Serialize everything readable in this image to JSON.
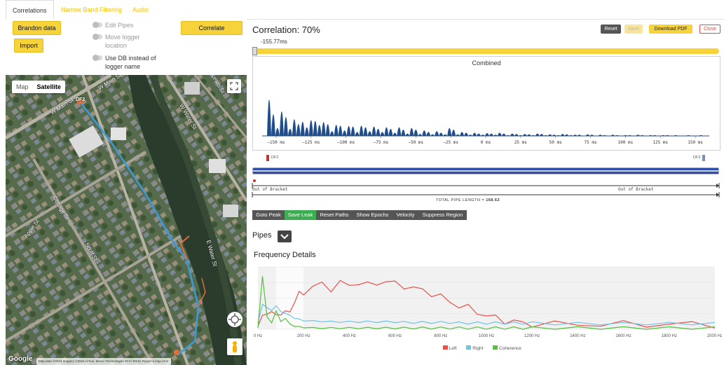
{
  "tabs": [
    {
      "label": "Correlations"
    },
    {
      "label": "Narrow Band Filtering"
    },
    {
      "label": "Audio"
    }
  ],
  "left": {
    "brandon_label": "Brandon data",
    "import_label": "Import",
    "correlate_label": "Correlate",
    "toggles": [
      {
        "label": "Edit Pipes",
        "on": false
      },
      {
        "label": "Move logger location",
        "on": false
      },
      {
        "label": "Use DB instead of logger name",
        "on": false
      }
    ],
    "map": {
      "type_map": "Map",
      "type_satellite": "Satellite",
      "selected_type": "Satellite",
      "street_labels": [
        "W Main St",
        "W Main St",
        "W Water St",
        "Lewis St",
        "Apple St",
        "Cottage St",
        "Scott St",
        "E Water St"
      ],
      "marker_top": "DF2",
      "attribution": "Map data ©2024 Imagery ©2024 Airbus, Maxar Technologies",
      "scale": "20 m",
      "terms": "Terms",
      "report": "Report a map error",
      "logo": "Google"
    }
  },
  "right": {
    "title": "Correlation: 70%",
    "reset_label": "Reset",
    "save_label": "Save",
    "download_label": "Download PDF",
    "close_label": "Close",
    "slider_value": "-155.77ms",
    "slider_position": 0.0,
    "combined_title": "Combined",
    "x_ticks": [
      "−150 ms",
      "−125 ms",
      "−100 ms",
      "−75 ms",
      "−50 ms",
      "−25 ms",
      "0 ms",
      "25 ms",
      "50 ms",
      "75 ms",
      "100 ms",
      "125 ms",
      "150 ms"
    ],
    "left_marker": "DF2",
    "right_marker": "DF3",
    "out_of_bracket_left": "Out of Bracket",
    "out_of_bracket_right": "Out of Bracket",
    "pipe_length_label": "TOTAL PIPE LENGTH = ",
    "pipe_length_value": "168.62",
    "toolbar": [
      {
        "label": "Goto Peak",
        "active": false
      },
      {
        "label": "Save Leak",
        "active": true
      },
      {
        "label": "Reset Paths",
        "active": false
      },
      {
        "label": "Show Epochs",
        "active": false
      },
      {
        "label": "Velocity",
        "active": false
      },
      {
        "label": "Suppress Region",
        "active": false
      }
    ],
    "pipes_label": "Pipes",
    "freq_title": "Frequency Details",
    "freq_ticks": [
      "0 Hz",
      "200 Hz",
      "400 Hz",
      "600 Hz",
      "800 Hz",
      "1000 Hz",
      "1200 Hz",
      "1400 Hz",
      "1600 Hz",
      "1800 Hz",
      "2000 Hz"
    ],
    "legend": [
      {
        "name": "Left",
        "color": "#e8504a"
      },
      {
        "name": "Right",
        "color": "#6fc2ea"
      },
      {
        "name": "Coherence",
        "color": "#52c23a"
      }
    ]
  },
  "colors": {
    "accent_yellow": "#f7d33b",
    "combined_fill": "#1f4e8c",
    "toolbar_bg": "#555555",
    "toolbar_active": "#3cad50"
  },
  "chart_data": [
    {
      "type": "area",
      "title": "Combined",
      "x_unit": "ms",
      "xlim": [
        -160,
        160
      ],
      "x": [
        -155,
        -152,
        -149,
        -146,
        -143,
        -140,
        -137,
        -134,
        -131,
        -128,
        -125,
        -122,
        -119,
        -116,
        -113,
        -110,
        -107,
        -104,
        -101,
        -98,
        -95,
        -92,
        -89,
        -86,
        -83,
        -80,
        -77,
        -74,
        -71,
        -68,
        -65,
        -62,
        -59,
        -56,
        -53,
        -50,
        -47,
        -44,
        -41,
        -38,
        -35,
        -32,
        -29,
        -26,
        -23,
        -20,
        -17,
        -14,
        -11,
        -8,
        -5,
        -2,
        1,
        4,
        7,
        10,
        13,
        16,
        19,
        22,
        25,
        28,
        31,
        34,
        37,
        40,
        43,
        46,
        49,
        52,
        55,
        58,
        61,
        64,
        67,
        70,
        73,
        76,
        79,
        82,
        85,
        88,
        91,
        94,
        97,
        100,
        103,
        106,
        109,
        112,
        115,
        118,
        121,
        124,
        127,
        130,
        133,
        136,
        139,
        142,
        145,
        148,
        151,
        154
      ],
      "y": [
        0.92,
        0.55,
        0.2,
        0.62,
        0.48,
        0.18,
        0.42,
        0.3,
        0.36,
        0.22,
        0.4,
        0.38,
        0.28,
        0.35,
        0.3,
        0.12,
        0.28,
        0.26,
        0.14,
        0.25,
        0.24,
        0.1,
        0.26,
        0.22,
        0.12,
        0.24,
        0.18,
        0.1,
        0.22,
        0.18,
        0.08,
        0.22,
        0.16,
        0.06,
        0.2,
        0.16,
        0.05,
        0.14,
        0.1,
        0.04,
        0.12,
        0.08,
        0.04,
        0.2,
        0.16,
        0.04,
        0.1,
        0.08,
        0.03,
        0.08,
        0.06,
        0.03,
        0.07,
        0.06,
        0.03,
        0.08,
        0.06,
        0.02,
        0.06,
        0.05,
        0.02,
        0.05,
        0.04,
        0.02,
        0.06,
        0.05,
        0.02,
        0.04,
        0.03,
        0.02,
        0.05,
        0.04,
        0.02,
        0.03,
        0.03,
        0.01,
        0.04,
        0.03,
        0.01,
        0.03,
        0.02,
        0.01,
        0.03,
        0.02,
        0.01,
        0.02,
        0.02,
        0.01,
        0.03,
        0.02,
        0.01,
        0.02,
        0.02,
        0.01,
        0.02,
        0.02,
        0.01,
        0.02,
        0.01,
        0.01,
        0.02,
        0.01,
        0.01,
        0.02
      ]
    },
    {
      "type": "line",
      "title": "Frequency Details",
      "x_unit": "Hz",
      "xlim": [
        0,
        2000
      ],
      "x": [
        0,
        20,
        40,
        60,
        80,
        100,
        120,
        140,
        160,
        180,
        200,
        240,
        280,
        320,
        360,
        400,
        440,
        480,
        520,
        560,
        600,
        640,
        680,
        720,
        760,
        800,
        840,
        880,
        920,
        960,
        1000,
        1040,
        1080,
        1120,
        1160,
        1200,
        1300,
        1400,
        1500,
        1600,
        1700,
        1800,
        1900,
        2000
      ],
      "series": [
        {
          "name": "Left",
          "values": [
            0.05,
            0.18,
            0.3,
            0.25,
            0.22,
            0.28,
            0.24,
            0.3,
            0.45,
            0.55,
            0.6,
            0.68,
            0.72,
            0.66,
            0.74,
            0.7,
            0.76,
            0.7,
            0.74,
            0.78,
            0.72,
            0.7,
            0.66,
            0.62,
            0.58,
            0.52,
            0.44,
            0.38,
            0.34,
            0.28,
            0.22,
            0.18,
            0.14,
            0.12,
            0.1,
            0.09,
            0.08,
            0.08,
            0.08,
            0.08,
            0.08,
            0.08,
            0.08,
            0.08
          ]
        },
        {
          "name": "Right",
          "values": [
            0.1,
            0.4,
            0.35,
            0.3,
            0.38,
            0.28,
            0.26,
            0.22,
            0.18,
            0.16,
            0.14,
            0.13,
            0.13,
            0.12,
            0.12,
            0.12,
            0.12,
            0.12,
            0.12,
            0.12,
            0.12,
            0.11,
            0.11,
            0.11,
            0.11,
            0.11,
            0.11,
            0.1,
            0.1,
            0.1,
            0.1,
            0.1,
            0.1,
            0.1,
            0.1,
            0.1,
            0.09,
            0.09,
            0.09,
            0.09,
            0.09,
            0.09,
            0.09,
            0.09
          ]
        },
        {
          "name": "Coherence",
          "values": [
            0.02,
            0.85,
            0.2,
            0.1,
            0.3,
            0.12,
            0.18,
            0.08,
            0.05,
            0.04,
            0.03,
            0.02,
            0.02,
            0.02,
            0.02,
            0.02,
            0.02,
            0.02,
            0.02,
            0.02,
            0.02,
            0.02,
            0.02,
            0.02,
            0.02,
            0.02,
            0.02,
            0.02,
            0.02,
            0.02,
            0.02,
            0.02,
            0.02,
            0.02,
            0.02,
            0.02,
            0.02,
            0.02,
            0.02,
            0.02,
            0.02,
            0.02,
            0.02,
            0.02
          ]
        }
      ]
    }
  ]
}
